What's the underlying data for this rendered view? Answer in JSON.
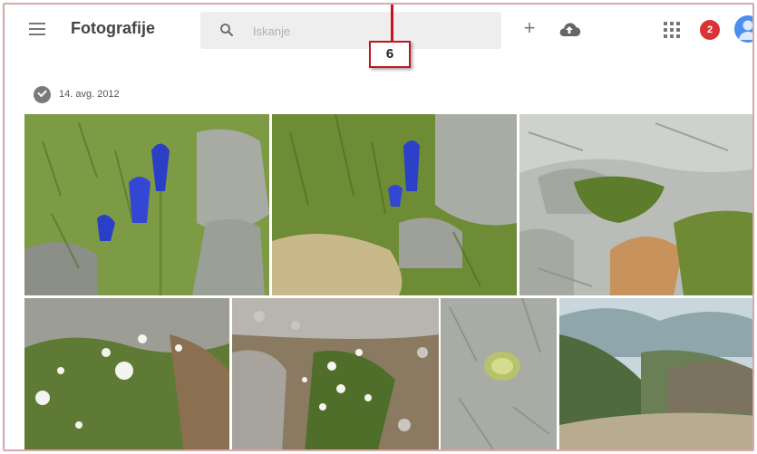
{
  "header": {
    "menu_icon": "menu-icon",
    "title": "Fotografije",
    "search": {
      "placeholder": "Iskanje",
      "icon": "search-icon"
    },
    "actions": [
      "plus-icon",
      "cloud-upload-icon",
      "apps-grid-icon"
    ],
    "notification_count": "2",
    "avatar": "account-avatar"
  },
  "annotation": {
    "label": "6",
    "color": "#c4141f"
  },
  "section": {
    "date": "14. avg. 2012",
    "photos": [
      "blue-gentian-flower-rocks",
      "blue-gentian-flower-grass",
      "limestone-rocks-moss",
      "white-alpine-flowers",
      "white-flowers-scree",
      "cushion-plant-rock",
      "mountain-valley-landscape"
    ]
  },
  "colors": {
    "accent": "#4a8ef0",
    "badge": "#db3236",
    "frame": "#d9a7ab"
  }
}
